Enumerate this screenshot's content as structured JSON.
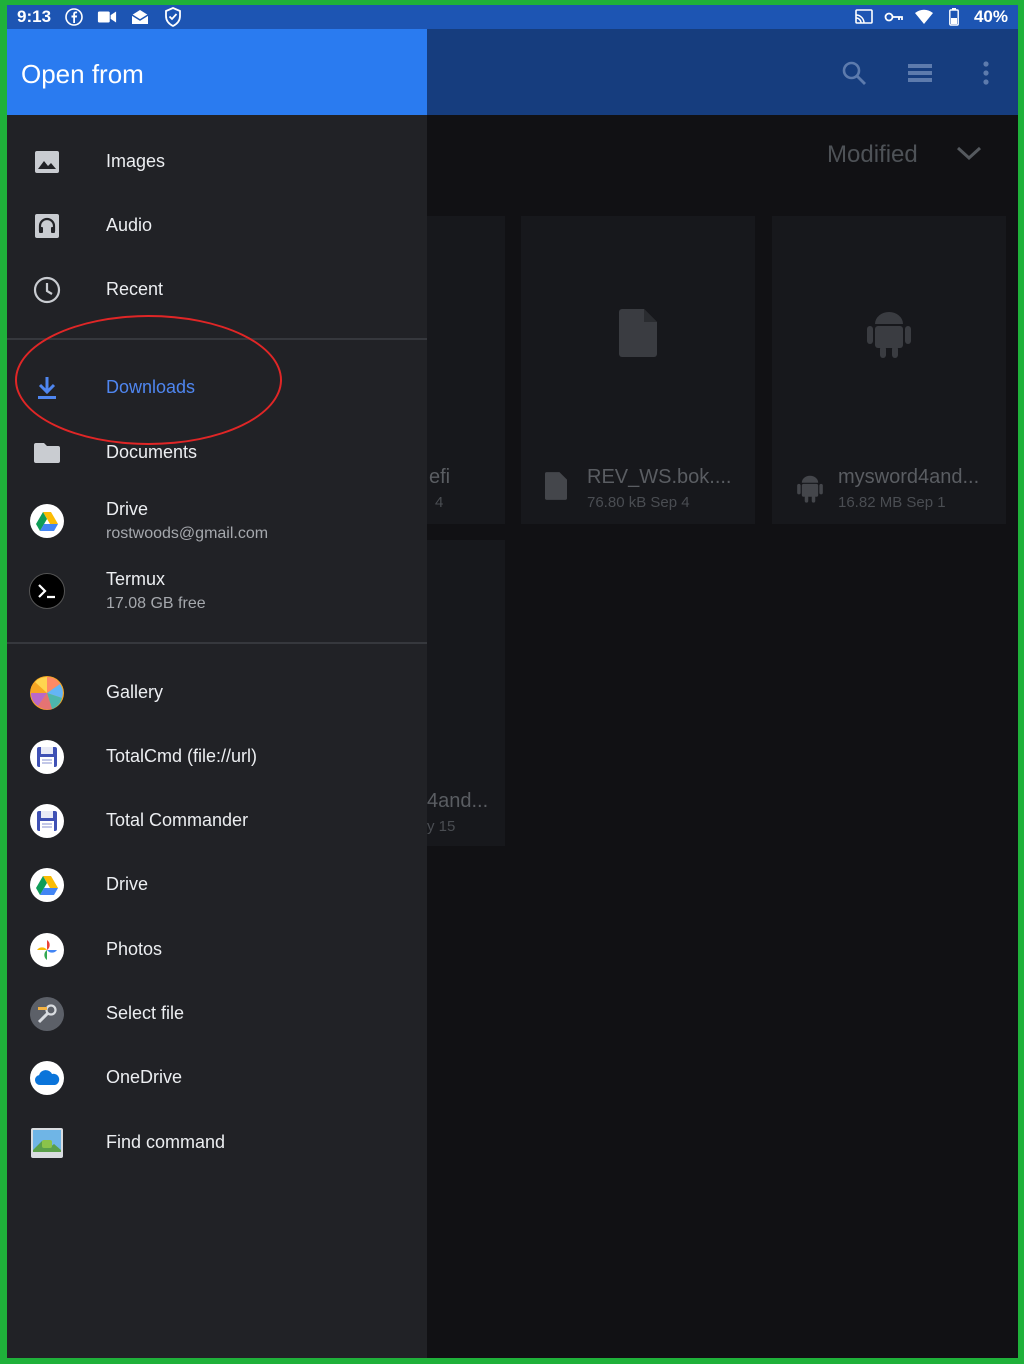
{
  "status_bar": {
    "time": "9:13",
    "battery": "40%",
    "icons_left": [
      "facebook-icon",
      "video-call-icon",
      "mail-icon",
      "shield-icon"
    ],
    "icons_right": [
      "cast-icon",
      "vpn-key-icon",
      "wifi-icon",
      "battery-icon"
    ]
  },
  "drawer": {
    "title": "Open from",
    "items": [
      {
        "label": "Images",
        "icon": "image-icon"
      },
      {
        "label": "Audio",
        "icon": "headphones-icon"
      },
      {
        "label": "Recent",
        "icon": "clock-icon"
      },
      {
        "label": "Downloads",
        "icon": "download-icon",
        "selected": true
      },
      {
        "label": "Documents",
        "icon": "folder-icon"
      },
      {
        "label": "Drive",
        "sublabel": "rostwoods@gmail.com",
        "icon": "google-drive-icon"
      },
      {
        "label": "Termux",
        "sublabel": "17.08 GB free",
        "icon": "termux-icon"
      },
      {
        "label": "Gallery",
        "icon": "gallery-icon"
      },
      {
        "label": "TotalCmd (file://url)",
        "icon": "floppy-disk-icon"
      },
      {
        "label": "Total Commander",
        "icon": "floppy-disk-icon"
      },
      {
        "label": "Drive",
        "icon": "google-drive-icon"
      },
      {
        "label": "Photos",
        "icon": "google-photos-icon"
      },
      {
        "label": "Select file",
        "icon": "tools-icon"
      },
      {
        "label": "OneDrive",
        "icon": "onedrive-icon"
      },
      {
        "label": "Find command",
        "icon": "android-image-icon"
      }
    ]
  },
  "toolbar": {
    "actions": [
      "search-icon",
      "list-view-icon",
      "more-vert-icon"
    ]
  },
  "sort": {
    "label": "Modified"
  },
  "files": [
    {
      "name": "efi",
      "info": "4"
    },
    {
      "name": "REV_WS.bok....",
      "info": "76.80 kB Sep 4",
      "icon": "file-icon"
    },
    {
      "name": "mysword4and...",
      "info": "16.82 MB Sep 1",
      "icon": "android-icon"
    },
    {
      "name": "4and...",
      "info": "y 15"
    }
  ],
  "colors": {
    "drawer_header": "#2a7bf0",
    "drawer_bg": "#212226",
    "selected_text": "#4f86f0",
    "annotation": "#e02626",
    "frame": "#1fb13a"
  }
}
